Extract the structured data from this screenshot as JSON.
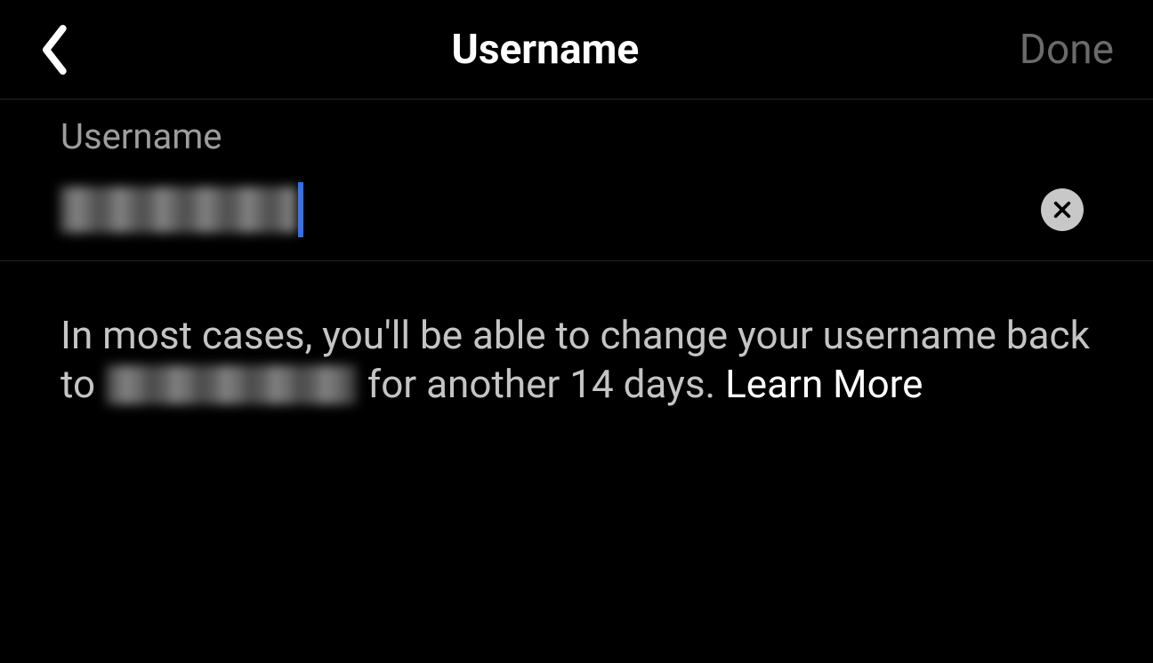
{
  "header": {
    "title": "Username",
    "done_label": "Done"
  },
  "field": {
    "label": "Username",
    "value_redacted": true
  },
  "helper": {
    "text_before": "In most cases, you'll be able to change your username back to ",
    "text_after": " for another 14 days. ",
    "previous_username_redacted": true,
    "learn_more_label": "Learn More"
  }
}
